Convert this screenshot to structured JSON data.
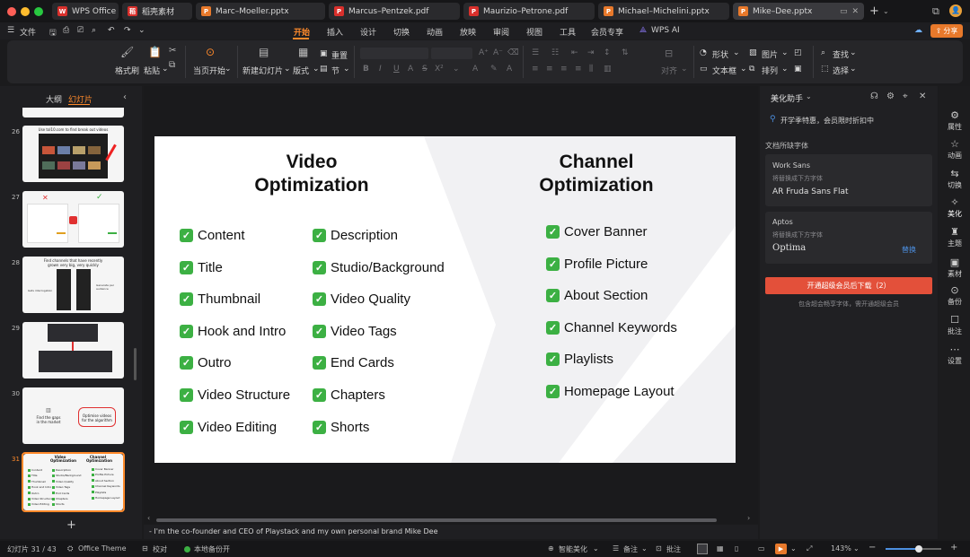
{
  "tabs": [
    {
      "label": "WPS Office",
      "icon": "W",
      "color": "#d9302c"
    },
    {
      "label": "稻壳素材",
      "icon": "稻",
      "color": "#d9302c"
    },
    {
      "label": "Marc–Moeller.pptx",
      "icon": "P",
      "color": "#e8792b"
    },
    {
      "label": "Marcus–Pentzek.pdf",
      "icon": "P",
      "color": "#d9302c"
    },
    {
      "label": "Maurizio–Petrone.pdf",
      "icon": "P",
      "color": "#d9302c"
    },
    {
      "label": "Michael–Michelini.pptx",
      "icon": "P",
      "color": "#e8792b"
    },
    {
      "label": "Mike–Dee.pptx",
      "icon": "P",
      "color": "#e8792b"
    }
  ],
  "menu": {
    "file": "文件",
    "items": [
      "开始",
      "插入",
      "设计",
      "切换",
      "动画",
      "放映",
      "审阅",
      "视图",
      "工具",
      "会员专享"
    ],
    "wps_ai": "WPS AI",
    "share": "分享"
  },
  "ribbon": {
    "format_painter": "格式刷",
    "paste": "粘贴",
    "from_current": "当页开始",
    "new_slide": "新建幻灯片",
    "layout": "版式",
    "section": "节",
    "reset": "重置",
    "align": "对齐",
    "shape": "形状",
    "textbox": "文本框",
    "picture": "图片",
    "arrange": "排列",
    "find": "查找",
    "select": "选择"
  },
  "left_panel": {
    "outline_tab": "大纲",
    "slides_tab": "幻灯片",
    "slide_numbers": [
      "26",
      "27",
      "28",
      "29",
      "30",
      "31"
    ],
    "thumb26_title": "Use tol10.com to find break out videos",
    "thumb28_title": "Find channels that have recently grown very big, very quickly",
    "thumb28_side_left": "Gets interrogation",
    "thumb28_side_right": "Generate per audience",
    "thumb30_left": "Find the gaps in the market",
    "thumb30_right": "Optimise videos for the algorithm"
  },
  "slide": {
    "heading_video": "Video\nOptimization",
    "heading_channel": "Channel\nOptimization",
    "col1": [
      "Content",
      "Title",
      "Thumbnail",
      "Hook and Intro",
      "Outro",
      "Video Structure",
      "Video Editing"
    ],
    "col2": [
      "Description",
      "Studio/Background",
      "Video Quality",
      "Video Tags",
      "End Cards",
      "Chapters",
      "Shorts"
    ],
    "col3": [
      "Cover Banner",
      "Profile Picture",
      "About Section",
      "Channel Keywords",
      "Playlists",
      "Homepage Layout"
    ]
  },
  "notes": "- I'm the co-founder and CEO of Playstack and my own personal brand Mike Dee",
  "right_panel": {
    "title": "美化助手",
    "promo": "开学季特惠，会员限时折扣中",
    "section": "文档所缺字体",
    "fonts": [
      {
        "missing": "Work Sans",
        "hint": "将替换成下方字体",
        "replacement": "AR Fruda Sans Flat",
        "action": ""
      },
      {
        "missing": "Aptos",
        "hint": "将替换成下方字体",
        "replacement": "Optima",
        "action": "替换"
      }
    ],
    "download_button": "开通超级会员后下载（2）",
    "download_note": "包含超会畅享字体，需开通超级会员"
  },
  "sidebar": [
    "属性",
    "动画",
    "切换",
    "美化",
    "主题",
    "素材",
    "备份",
    "批注",
    "设置"
  ],
  "status": {
    "slide_count": "幻灯片 31 / 43",
    "theme": "Office Theme",
    "proof": "校对",
    "backup": "本地备份开",
    "smart_beautify": "智能美化",
    "notes": "备注",
    "comments": "批注",
    "zoom": "143%"
  },
  "colors": {
    "accent": "#e8792b",
    "check": "#3cb043",
    "download": "#e3503a",
    "link": "#4c8fe0"
  }
}
